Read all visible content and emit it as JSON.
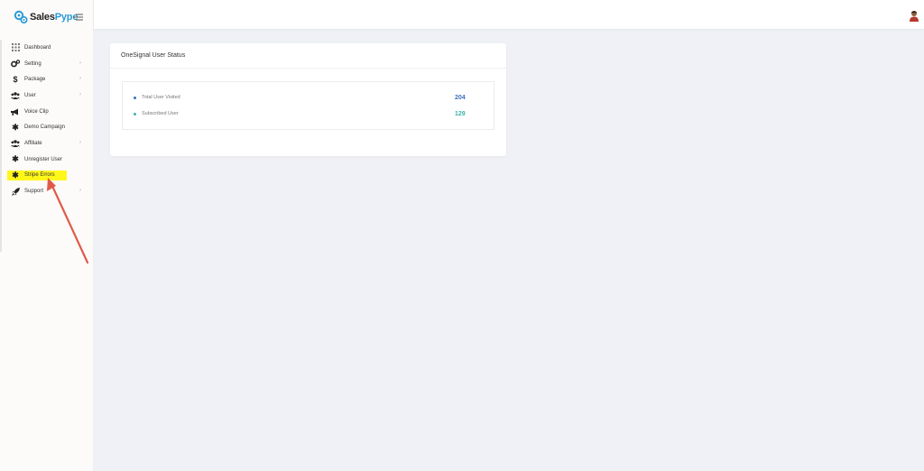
{
  "brand": {
    "part1": "Sales",
    "part2": "Pype"
  },
  "sidebar": {
    "items": [
      {
        "label": "Dashboard",
        "icon": "grid-icon",
        "chevron": false
      },
      {
        "label": "Setting",
        "icon": "gears-icon",
        "chevron": true
      },
      {
        "label": "Package",
        "icon": "dollar-icon",
        "chevron": true
      },
      {
        "label": "User",
        "icon": "users-icon",
        "chevron": true
      },
      {
        "label": "Voice Clip",
        "icon": "megaphone-icon",
        "chevron": false
      },
      {
        "label": "Demo Campaign",
        "icon": "asterisk-icon",
        "chevron": false
      },
      {
        "label": "Affiliate",
        "icon": "users-icon",
        "chevron": true
      },
      {
        "label": "Unregister User",
        "icon": "asterisk-icon",
        "chevron": false
      },
      {
        "label": "Stripe Errors",
        "icon": "asterisk-icon",
        "chevron": false,
        "highlighted": true
      },
      {
        "label": "Support",
        "icon": "rocket-icon",
        "chevron": true
      }
    ]
  },
  "card": {
    "title": "OneSignal User Status",
    "stats": [
      {
        "label": "Total User Visited",
        "value": "204",
        "color": "#3a6fbf"
      },
      {
        "label": "Subscribed User",
        "value": "129",
        "color": "#3cb3a7"
      }
    ]
  },
  "colors": {
    "highlight": "#fff71a",
    "annotation_arrow": "#e05a4a",
    "brand_accent": "#2b9bd6"
  }
}
